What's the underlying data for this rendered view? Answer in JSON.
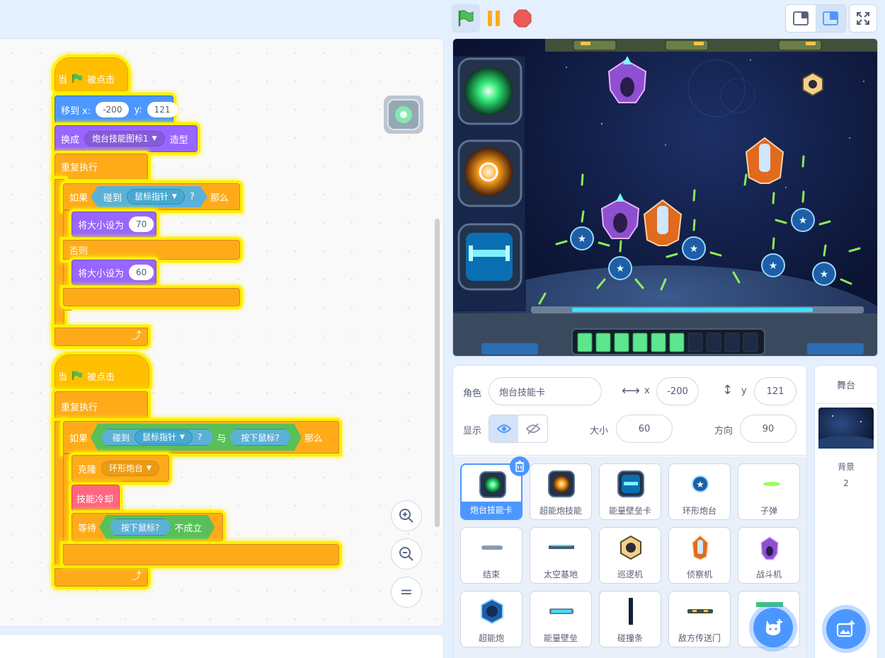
{
  "script1": {
    "hat_when": "当",
    "hat_clicked": "被点击",
    "goto_label": "移到 x:",
    "goto_x": "-200",
    "goto_y_label": "y:",
    "goto_y": "121",
    "costume_label": "换成",
    "costume_value": "炮台技能图标1",
    "costume_suffix": "造型",
    "forever": "重复执行",
    "if": "如果",
    "touching": "碰到",
    "mouse_pointer": "鼠标指针",
    "question": "?",
    "then": "那么",
    "set_size": "将大小设为",
    "size_a": "70",
    "else": "否则",
    "size_b": "60"
  },
  "script2": {
    "hat_when": "当",
    "hat_clicked": "被点击",
    "forever": "重复执行",
    "if": "如果",
    "touching": "碰到",
    "mouse_pointer": "鼠标指针",
    "question": "?",
    "and": "与",
    "mouse_down": "按下鼠标?",
    "then": "那么",
    "clone_label": "克隆",
    "clone_target": "环形炮台",
    "cooldown": "技能冷却",
    "wait": "等待",
    "not_true": "不成立"
  },
  "zoom": {
    "in": "+",
    "out": "−",
    "reset": "="
  },
  "sprite_info": {
    "sprite_label": "角色",
    "sprite_name": "炮台技能卡",
    "x_label": "x",
    "x_value": "-200",
    "y_label": "y",
    "y_value": "121",
    "show_label": "显示",
    "size_label": "大小",
    "size_value": "60",
    "direction_label": "方向",
    "direction_value": "90"
  },
  "sprites": [
    {
      "name": "炮台技能卡",
      "icon": "green-core-card-icon"
    },
    {
      "name": "超能炮技能",
      "icon": "orange-core-card-icon"
    },
    {
      "name": "能量壁垒卡",
      "icon": "blue-barrier-card-icon"
    },
    {
      "name": "环形炮台",
      "icon": "star-turret-icon"
    },
    {
      "name": "子弹",
      "icon": "bullet-icon"
    },
    {
      "name": "结束",
      "icon": "end-icon"
    },
    {
      "name": "太空基地",
      "icon": "space-base-icon"
    },
    {
      "name": "巡逻机",
      "icon": "patrol-ship-icon"
    },
    {
      "name": "侦察机",
      "icon": "scout-ship-icon"
    },
    {
      "name": "战斗机",
      "icon": "fighter-ship-icon"
    },
    {
      "name": "超能炮",
      "icon": "super-cannon-icon"
    },
    {
      "name": "能量壁垒",
      "icon": "energy-barrier-icon"
    },
    {
      "name": "碰撞条",
      "icon": "collision-bar-icon"
    },
    {
      "name": "敌方传送门",
      "icon": "enemy-portal-icon"
    },
    {
      "name": "",
      "icon": "energy-bar-icon"
    }
  ],
  "stage_panel": {
    "title": "舞台",
    "backdrop_label": "背景",
    "backdrop_count": "2"
  },
  "stage": {
    "energy_total": 10,
    "energy_filled": 6
  },
  "colors": {
    "events": "#ffbf00",
    "control": "#ffab19",
    "motion": "#4c97ff",
    "looks": "#9966ff",
    "sensing": "#5cb1d6",
    "operators": "#59c059",
    "custom": "#ff6680",
    "accent": "#4c97ff"
  }
}
